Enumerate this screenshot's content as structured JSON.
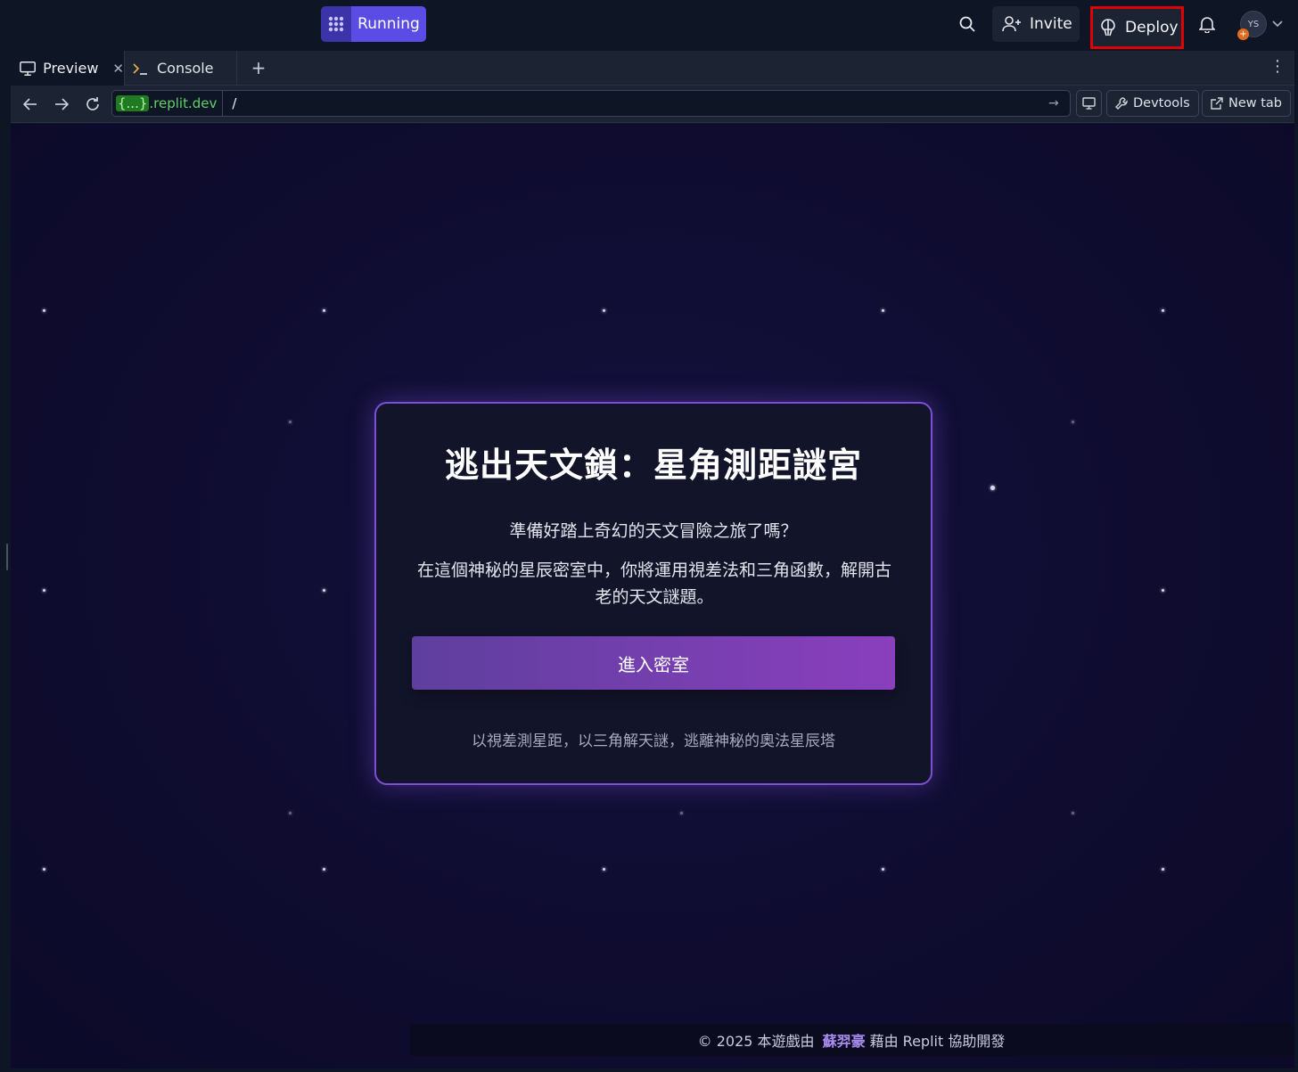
{
  "topbar": {
    "run_label": "Running",
    "invite_label": "Invite",
    "deploy_label": "Deploy",
    "avatar_initials": "YS"
  },
  "tabs": [
    {
      "label": "Preview",
      "icon": "monitor-icon"
    },
    {
      "label": "Console",
      "icon": "terminal-icon"
    }
  ],
  "urlbar": {
    "host_code": "{...}",
    "host_domain": ".replit.dev",
    "path": "/",
    "devtools_label": "Devtools",
    "newtab_label": "New tab"
  },
  "game": {
    "title": "逃出天文鎖：星角測距謎宮",
    "subtitle": "準備好踏上奇幻的天文冒險之旅了嗎？",
    "description": "在這個神秘的星辰密室中，你將運用視差法和三角函數，解開古老的天文謎題。",
    "enter_button": "進入密室",
    "tagline": "以視差測星距，以三角解天謎，逃離神秘的奧法星辰塔"
  },
  "footer": {
    "prefix": "© 2025 本遊戲由",
    "author": "蘇羿豪",
    "suffix": "藉由 Replit 協助開發"
  },
  "colors": {
    "accent": "#5b4ce6",
    "deploy_highlight": "#e00000",
    "card_border": "#7c4fd6",
    "button_gradient_start": "#5e3f9e",
    "button_gradient_end": "#8a3fbd"
  }
}
